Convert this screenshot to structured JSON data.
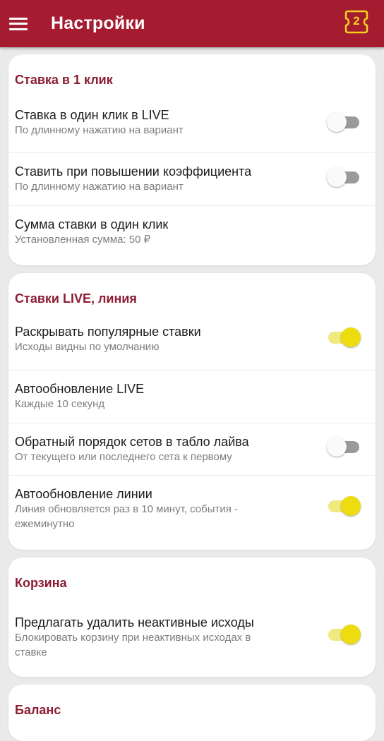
{
  "header": {
    "title": "Настройки",
    "menu_icon": "hamburger-icon",
    "coupon_icon": "coupon-icon",
    "coupon_count": "2",
    "colors": {
      "bar": "#a51b30",
      "count": "#f3d21c"
    }
  },
  "sections": {
    "one_click": {
      "title": "Ставка в 1 клик",
      "items": [
        {
          "label": "Ставка в один клик в LIVE",
          "sub": "По длинному нажатию на вариант",
          "toggle": "off"
        },
        {
          "label": "Ставить при повышении коэффициента",
          "sub": "По длинному нажатию на вариант",
          "toggle": "off"
        },
        {
          "label": "Сумма ставки в один клик",
          "sub": "Установленная сумма: 50 ₽"
        }
      ]
    },
    "live": {
      "title": "Ставки LIVE, линия",
      "items": [
        {
          "label": "Раскрывать популярные ставки",
          "sub": "Исходы видны по умолчанию",
          "toggle": "on"
        },
        {
          "label": "Автообновление LIVE",
          "sub": "Каждые 10 секунд"
        },
        {
          "label": "Обратный порядок сетов в табло лайва",
          "sub": "От текущего или последнего сета к первому",
          "toggle": "off"
        },
        {
          "label": "Автообновление линии",
          "sub": "Линия обновляется раз в 10 минут, события - ежеминутно",
          "toggle": "on"
        }
      ]
    },
    "cart": {
      "title": "Корзина",
      "items": [
        {
          "label": "Предлагать удалить неактивные исходы",
          "sub": "Блокировать корзину при неактивных исходах в ставке",
          "toggle": "on"
        }
      ]
    },
    "balance": {
      "title": "Баланс"
    }
  },
  "colors": {
    "section_title": "#8c1d33",
    "toggle_on": "#eddd0e",
    "toggle_off": "#9a9a9a"
  }
}
